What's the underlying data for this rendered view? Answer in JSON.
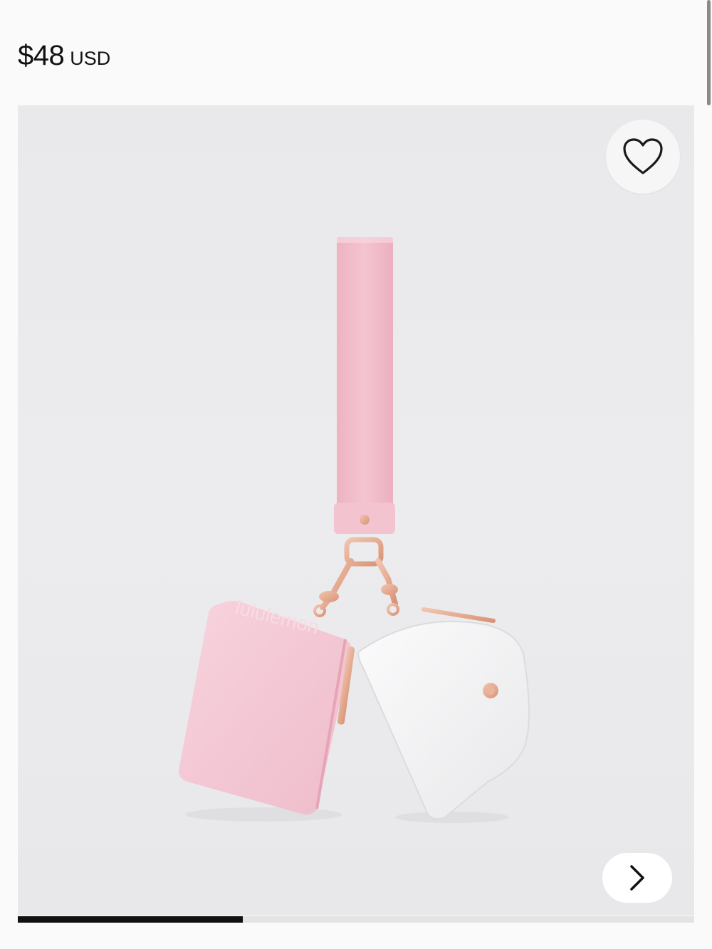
{
  "product": {
    "price_amount": "$48",
    "price_currency": "USD",
    "image_alt": "Pink and white dual pouch wristlet",
    "logo_text": "lululemon"
  },
  "icons": {
    "wishlist": "heart-icon",
    "next": "chevron-right-icon"
  },
  "gallery": {
    "progress": 0.333
  },
  "colors": {
    "text": "#111111",
    "strap_pink": "#f1bccb",
    "pouch_pink": "#f4c9d5",
    "pouch_white": "#f5f5f6",
    "hardware_rose_gold": "#e3a98f"
  }
}
